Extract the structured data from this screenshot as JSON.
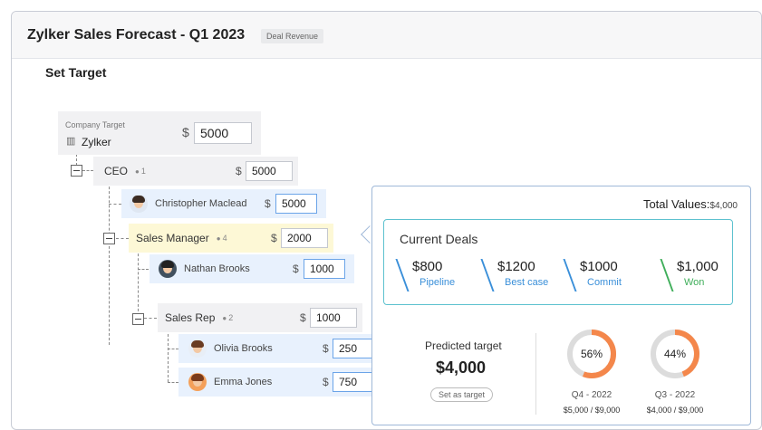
{
  "header": {
    "title": "Zylker Sales Forecast - Q1 2023",
    "badge": "Deal Revenue"
  },
  "section_title": "Set Target",
  "company": {
    "label": "Company Target",
    "name": "Zylker",
    "currency": "$",
    "value": "5000",
    "icon": "building-icon"
  },
  "tree": {
    "ceo": {
      "name": "CEO",
      "count": "1",
      "currency": "$",
      "value": "5000"
    },
    "christopher": {
      "name": "Christopher Maclead",
      "currency": "$",
      "value": "5000"
    },
    "sales_manager": {
      "name": "Sales Manager",
      "count": "4",
      "currency": "$",
      "value": "2000"
    },
    "nathan": {
      "name": "Nathan Brooks",
      "currency": "$",
      "value": "1000"
    },
    "sales_rep": {
      "name": "Sales Rep",
      "count": "2",
      "currency": "$",
      "value": "1000"
    },
    "olivia": {
      "name": "Olivia Brooks",
      "currency": "$",
      "value": "250"
    },
    "emma": {
      "name": "Emma Jones",
      "currency": "$",
      "value": "750"
    }
  },
  "popover": {
    "total_label": "Total Values:",
    "total_value": "$4,000",
    "current_deals_title": "Current Deals",
    "deals": [
      {
        "amount": "$800",
        "label": "Pipeline",
        "color": "#3a8fd9"
      },
      {
        "amount": "$1200",
        "label": "Best case",
        "color": "#3a8fd9"
      },
      {
        "amount": "$1000",
        "label": "Commit",
        "color": "#3a8fd9"
      },
      {
        "amount": "$1,000",
        "label": "Won",
        "color": "#3fae5a"
      }
    ],
    "predicted_label": "Predicted target",
    "predicted_value": "$4,000",
    "set_as_target": "Set as target",
    "periods": [
      {
        "percent": "56%",
        "fraction": 0.56,
        "period": "Q4 - 2022",
        "ratio": "$5,000 / $9,000"
      },
      {
        "percent": "44%",
        "fraction": 0.44,
        "period": "Q3 - 2022",
        "ratio": "$4,000 / $9,000"
      }
    ]
  },
  "colors": {
    "accent_orange": "#f4874b",
    "donut_track": "#dcdcdc",
    "deals_border": "#5dc1cf",
    "won_green": "#3fae5a",
    "link_blue": "#3a8fd9"
  }
}
